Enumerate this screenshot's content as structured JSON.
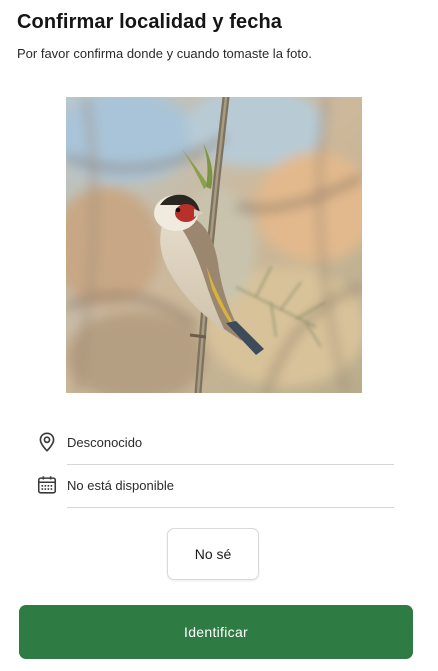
{
  "header": {
    "title": "Confirmar localidad y fecha",
    "subtitle": "Por favor confirma donde y cuando tomaste la foto."
  },
  "photo": {
    "subject": "goldfinch perched on reed stem"
  },
  "location": {
    "icon": "location-pin-icon",
    "value": "Desconocido"
  },
  "date": {
    "icon": "calendar-icon",
    "value": "No está disponible"
  },
  "actions": {
    "unknown_label": "No sé",
    "identify_label": "Identificar"
  },
  "colors": {
    "accent": "#2e7b43",
    "divider": "#d6d6d6"
  }
}
